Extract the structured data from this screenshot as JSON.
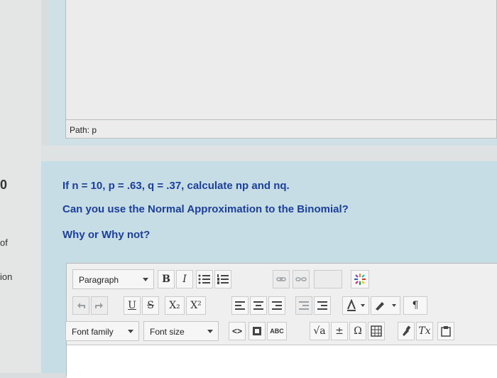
{
  "top_editor": {
    "path_label": "Path: p"
  },
  "sidebar_fragments": {
    "number": "0",
    "frag_of": "of",
    "frag_ion": "ion"
  },
  "question": {
    "line1": "If n = 10, p = .63, q = .37, calculate np and nq.",
    "line2": "Can you use the Normal Approximation to the Binomial?",
    "line3": "Why or Why not?"
  },
  "toolbar": {
    "paragraph_select": "Paragraph",
    "bold": "B",
    "italic": "I",
    "underline": "U",
    "strike": "S",
    "subscript": "X₂",
    "superscript": "X²",
    "pilcrow": "¶",
    "font_family_select": "Font family",
    "font_size_select": "Font size",
    "code": "<>",
    "omega": "Ω",
    "clear_format": "Tx",
    "sqrt": "√a",
    "plus_minus": "±",
    "abc": "ABC"
  }
}
